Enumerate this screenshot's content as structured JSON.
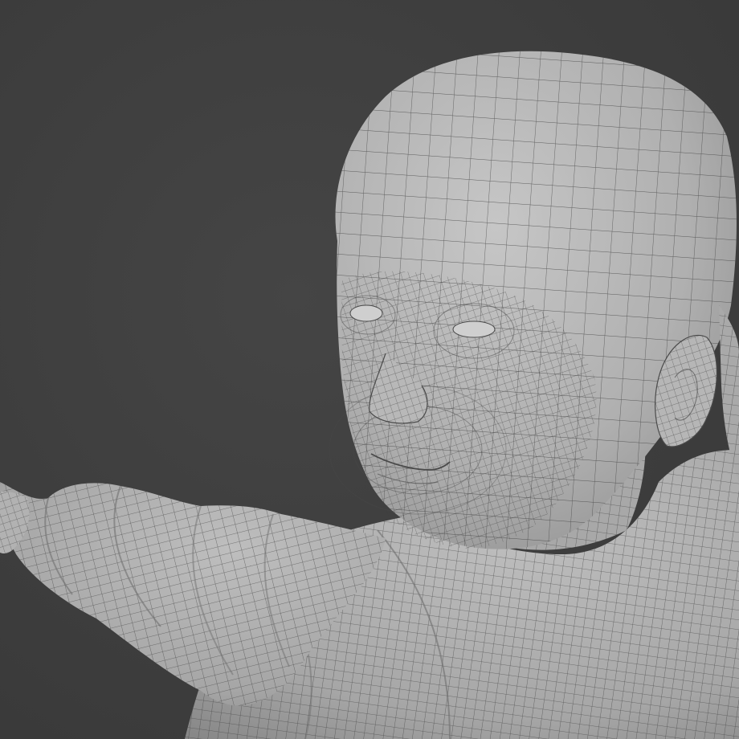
{
  "viewport": {
    "background_color": "#3f3f3f",
    "mesh_fill_color": "#b4b4b4",
    "wire_color": "#3c3c3c",
    "display_mode": "solid-with-wireframe-overlay",
    "subject": "child-figure-sculpt-mesh"
  }
}
